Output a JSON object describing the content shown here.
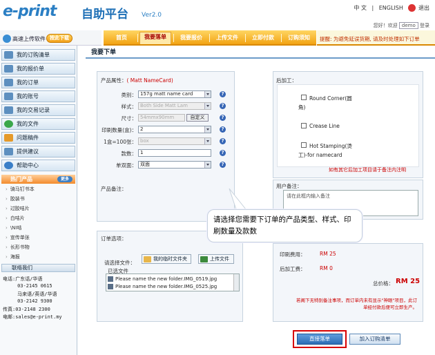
{
  "header": {
    "logo_text": "e-print",
    "logo_cn": "自助平台",
    "version": "Ver2.0",
    "lang_cn": "中 文",
    "lang_en": "ENGLISH",
    "exit": "退出",
    "greeting": "您好！欢迎",
    "username": "demo",
    "login_suffix": "登录"
  },
  "upload": {
    "label": "高速上传软件",
    "button": "按此下载"
  },
  "nav": {
    "items": [
      "首页",
      "我要落单",
      "我要报价",
      "上传文件",
      "立即付款",
      "订购须知"
    ],
    "notice": "提醒: 为避免延误货期, 请及时处理如下订单"
  },
  "sidebar": {
    "items": [
      "我的订购清单",
      "我的报价单",
      "我的订单",
      "我的账号",
      "我的交易记录",
      "我的文件",
      "问题稿件",
      "提供建议",
      "帮助中心"
    ],
    "hot_title": "热门产品",
    "more": "更多",
    "products": [
      "骑马钉书本",
      "胶装书",
      "过胶咭片",
      "白咭片",
      "\\NI咭",
      "宣传单张",
      "长形书物",
      "海报"
    ],
    "contact_title": "联络我们",
    "contact_lines": [
      "电话:广东话/华语",
      "     03-2145 0615",
      "     马来语/英语/华语",
      "     03-2142 9300",
      "传真:03-2148 2300",
      "电邮:sales@e-print.my"
    ]
  },
  "main": {
    "title": "我要下单",
    "product_attr_label": "产品属性：",
    "product_attr_value": "( Matt NameCard)",
    "fields": [
      {
        "label": "类别：",
        "value": "157g matt name card",
        "disabled": false
      },
      {
        "label": "样式：",
        "value": "Both Side Matt Lam",
        "disabled": true
      },
      {
        "label": "尺寸：",
        "value": "54mmx90mm",
        "disabled": true
      },
      {
        "label": "印刷数量(盒)：",
        "value": "2",
        "disabled": false
      },
      {
        "label": "1盒=100张：",
        "value": "box",
        "disabled": true
      },
      {
        "label": "款数：",
        "value": "1",
        "disabled": false
      },
      {
        "label": "单双面：",
        "value": "双面",
        "disabled": false
      }
    ],
    "custom_btn": "自定义",
    "product_note_label": "产品备注：",
    "postprocess_label": "后加工：",
    "post_options": [
      "Round Corner(圆",
      "角)",
      "Crease Line",
      "Hot Stamping(烫",
      "工)-for namecard"
    ],
    "post_note": "如有其它后加工项目请于备注内注明",
    "user_note_label": "用户备注：",
    "user_note_placeholder": "请在此框内输入备注",
    "order_options_label": "订单选项：",
    "select_file_label": "请选择文件：",
    "my_folder_btn": "我的临时文件夹",
    "upload_btn": "上传文件",
    "selected_files_label": "已选文件",
    "files": [
      "Please name the new folder.IMG_0519.jpg",
      "Please name the new folder.IMG_0525.jpg"
    ],
    "print_fee_label": "印刷费用：",
    "print_fee": "RM 25",
    "post_fee_label": "后加工费：",
    "post_fee": "RM 0",
    "total_label": "总价格：",
    "total": "RM 25",
    "disclaimer": "若阁下无特别备注事项，而订单内未有显示\"神眼\"项目，此订单经付款后便可立即生产。",
    "submit_btn": "直接落单",
    "add_list_btn": "加入订购清单"
  },
  "callout": {
    "text": "请选择您需要下订单的产品类型、样式、印刷数量及款数"
  }
}
